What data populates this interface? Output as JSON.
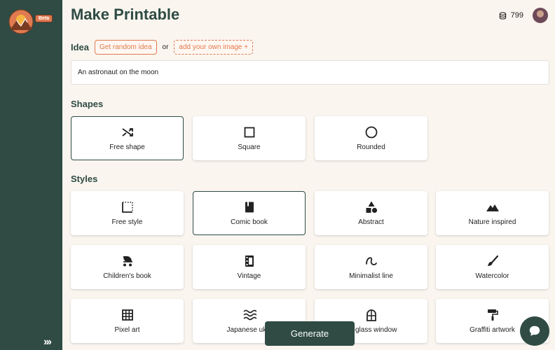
{
  "app": {
    "badge": "Beta"
  },
  "header": {
    "title": "Make Printable",
    "credits": "799"
  },
  "idea": {
    "label": "Idea",
    "random_label": "Get random idea",
    "or": "or",
    "image_label": "add your own image +",
    "value": "An astronaut on the moon"
  },
  "shapes": {
    "title": "Shapes",
    "items": [
      {
        "label": "Free shape",
        "icon": "shuffle-icon",
        "selected": true
      },
      {
        "label": "Square",
        "icon": "square-icon",
        "selected": false
      },
      {
        "label": "Rounded",
        "icon": "circle-icon",
        "selected": false
      }
    ]
  },
  "styles": {
    "title": "Styles",
    "items": [
      {
        "label": "Free style",
        "icon": "dotted-frame-icon",
        "selected": false
      },
      {
        "label": "Comic book",
        "icon": "book-icon",
        "selected": true
      },
      {
        "label": "Abstract",
        "icon": "shapes-icon",
        "selected": false
      },
      {
        "label": "Nature inspired",
        "icon": "mountains-icon",
        "selected": false
      },
      {
        "label": "Children's book",
        "icon": "stroller-icon",
        "selected": false
      },
      {
        "label": "Vintage",
        "icon": "film-icon",
        "selected": false
      },
      {
        "label": "Minimalist line",
        "icon": "squiggle-icon",
        "selected": false
      },
      {
        "label": "Watercolor",
        "icon": "brush-icon",
        "selected": false
      },
      {
        "label": "Pixel art",
        "icon": "grid-icon",
        "selected": false
      },
      {
        "label": "Japanese ukiy",
        "icon": "waves-icon",
        "selected": false
      },
      {
        "label": "ed-glass window",
        "icon": "window-icon",
        "selected": false
      },
      {
        "label": "Graffiti artwork",
        "icon": "paint-roller-icon",
        "selected": false
      }
    ]
  },
  "actions": {
    "generate_label": "Generate"
  },
  "colors": {
    "brand": "#2f4b44",
    "accent": "#e07a50",
    "background": "#faf5ef"
  }
}
